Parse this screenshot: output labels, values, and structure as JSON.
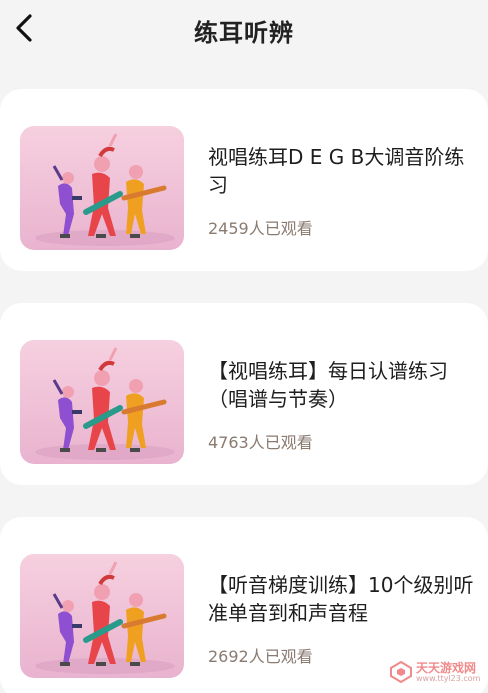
{
  "header": {
    "title": "练耳听辨",
    "back_icon": "chevron-left-icon"
  },
  "courses": [
    {
      "title": "视唱练耳D E G B大调音阶练习",
      "views": "2459",
      "views_suffix": "人已观看",
      "thumbnail": "dancing-band-illustration"
    },
    {
      "title": "【视唱练耳】每日认谱练习（唱谱与节奏）",
      "views": "4763",
      "views_suffix": "人已观看",
      "thumbnail": "dancing-band-illustration"
    },
    {
      "title": "【听音梯度训练】10个级别听准单音到和声音程",
      "views": "2692",
      "views_suffix": "人已观看",
      "thumbnail": "dancing-band-illustration"
    }
  ],
  "watermark": {
    "name": "天天游戏网",
    "url": "www.ttyl23.com"
  },
  "colors": {
    "background": "#f4f4f4",
    "card": "#ffffff",
    "views_text": "#8a7a70",
    "thumb_bg": "#f3c7d8"
  }
}
